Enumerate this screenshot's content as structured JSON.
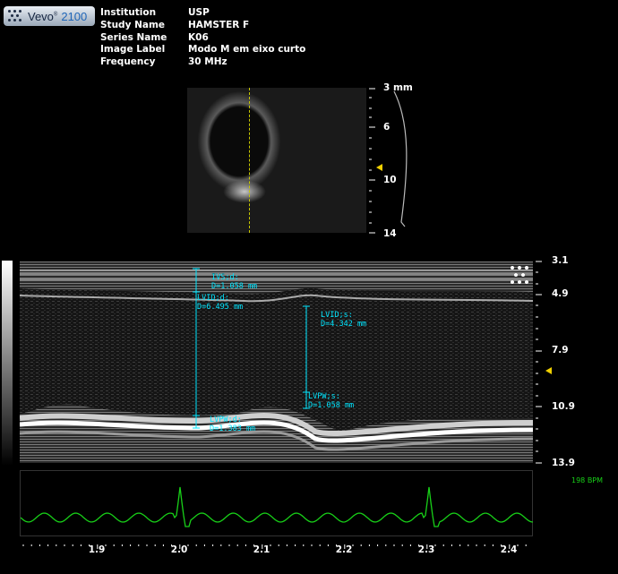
{
  "app": {
    "brand": "Vevo",
    "brand_sup": "®",
    "model": "2100"
  },
  "info": {
    "rows": [
      {
        "key": "Institution",
        "value": "USP"
      },
      {
        "key": "Study Name",
        "value": "HAMSTER F"
      },
      {
        "key": "Series Name",
        "value": "K06"
      },
      {
        "key": "Image Label",
        "value": "Modo M em eixo curto"
      },
      {
        "key": "Frequency",
        "value": "30 MHz"
      }
    ]
  },
  "bmode_depth": {
    "labels": [
      "3 mm",
      "6",
      "10",
      "14"
    ]
  },
  "mmode_depth": {
    "labels": [
      "3.1",
      "4.9",
      "7.9",
      "10.9",
      "13.9"
    ]
  },
  "measurements": {
    "diastole": [
      {
        "name": "IVS;d:",
        "value": "D=1.058 mm"
      },
      {
        "name": "LVID;d:",
        "value": "D=6.495 mm"
      },
      {
        "name": "LVPW;d:",
        "value": "D=1.383 mm"
      }
    ],
    "systole": [
      {
        "name": "LVID;s:",
        "value": "D=4.342 mm"
      },
      {
        "name": "LVPW;s:",
        "value": "D=1.058 mm"
      }
    ]
  },
  "ecg": {
    "heart_rate": "198 BPM"
  },
  "time_axis": {
    "labels": [
      "1.9",
      "2.0",
      "2.1",
      "2.2",
      "2.3",
      "2.4"
    ]
  },
  "colors": {
    "measure": "#00e5ff",
    "ecg": "#18d018",
    "depth_marker": "#f0d000"
  }
}
